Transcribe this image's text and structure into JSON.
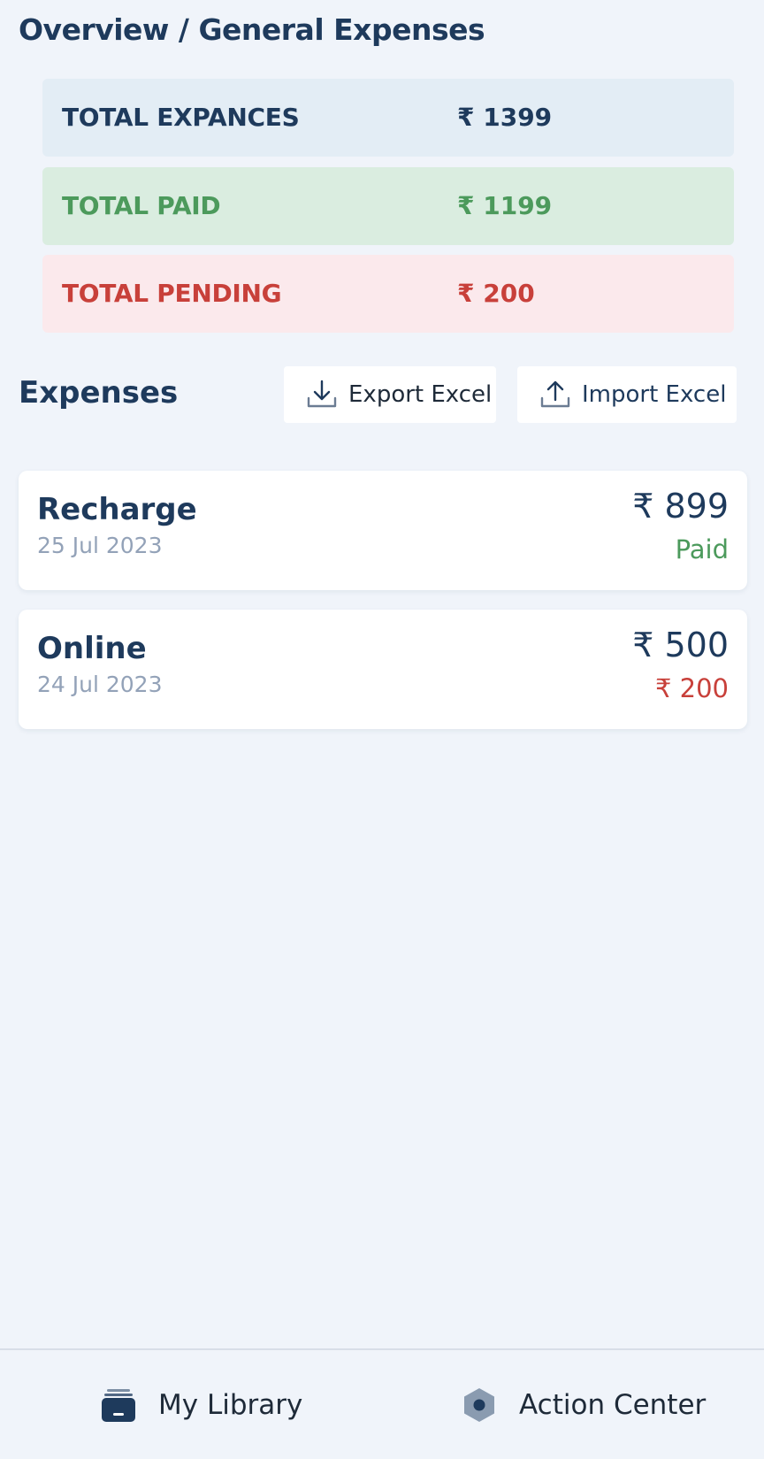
{
  "header": {
    "title": "Overview / General Expenses"
  },
  "summary": {
    "total": {
      "label": "TOTAL EXPANCES",
      "value": "₹ 1399"
    },
    "paid": {
      "label": "TOTAL PAID",
      "value": "₹ 1199"
    },
    "pending": {
      "label": "TOTAL PENDING",
      "value": "₹ 200"
    }
  },
  "expenses": {
    "title": "Expenses",
    "export_label": "Export Excel",
    "import_label": "Import Excel",
    "items": [
      {
        "name": "Recharge",
        "date": "25 Jul 2023",
        "amount": "₹ 899",
        "status": "Paid"
      },
      {
        "name": "Online",
        "date": "24 Jul 2023",
        "amount": "₹ 500",
        "status": "₹ 200"
      }
    ]
  },
  "bottom_nav": {
    "library": {
      "label": "My Library",
      "icon": "library-icon"
    },
    "action_center": {
      "label": "Action Center",
      "icon": "hexagon-icon"
    }
  },
  "colors": {
    "primary": "#1e3a5c",
    "paid": "#4c9a5c",
    "pending": "#c8403a",
    "background": "#f0f4fa"
  }
}
